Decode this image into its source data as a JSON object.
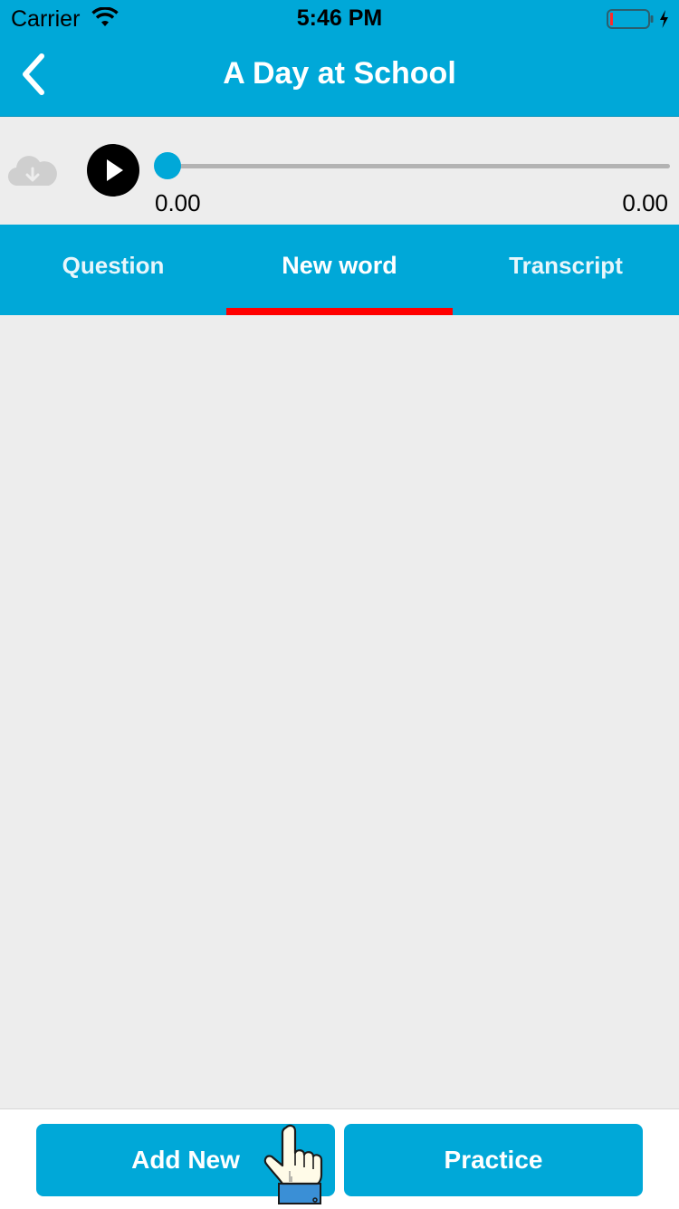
{
  "status_bar": {
    "carrier": "Carrier",
    "time": "5:46 PM"
  },
  "nav": {
    "title": "A Day at School",
    "back_icon": "chevron-left-icon"
  },
  "player": {
    "cloud_icon": "cloud-download-icon",
    "play_icon": "play-icon",
    "progress": 0,
    "current_time": "0.00",
    "duration": "0.00"
  },
  "tabs": [
    {
      "label": "Question",
      "active": false
    },
    {
      "label": "New word",
      "active": true
    },
    {
      "label": "Transcript",
      "active": false
    }
  ],
  "actions": {
    "add_new": "Add New",
    "practice": "Practice"
  },
  "colors": {
    "primary": "#00a8d8",
    "tab_indicator": "#ff0000",
    "background": "#ededed"
  }
}
